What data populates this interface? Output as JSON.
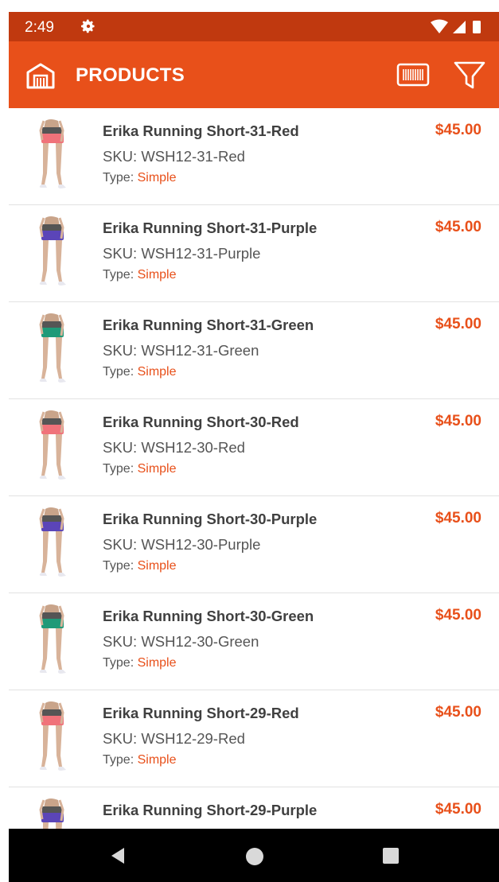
{
  "status_bar": {
    "time": "2:49",
    "icons": [
      "gear-icon",
      "wifi-icon",
      "signal-icon",
      "battery-icon"
    ]
  },
  "app_bar": {
    "title": "PRODUCTS",
    "icons": [
      "store-icon",
      "barcode-scan-icon",
      "filter-icon"
    ]
  },
  "theme": {
    "primary": "#e8501a",
    "status_bar": "#c0390f",
    "text_dark": "#404040",
    "text_muted": "#555555"
  },
  "products": [
    {
      "name": "Erika Running Short-31-Red",
      "sku": "SKU: WSH12-31-Red",
      "type_label": "Type:",
      "type_value": "Simple",
      "price": "$45.00",
      "color": "#f0727a"
    },
    {
      "name": "Erika Running Short-31-Purple",
      "sku": "SKU: WSH12-31-Purple",
      "type_label": "Type:",
      "type_value": "Simple",
      "price": "$45.00",
      "color": "#5b45b8"
    },
    {
      "name": "Erika Running Short-31-Green",
      "sku": "SKU: WSH12-31-Green",
      "type_label": "Type:",
      "type_value": "Simple",
      "price": "$45.00",
      "color": "#1f9a78"
    },
    {
      "name": "Erika Running Short-30-Red",
      "sku": "SKU: WSH12-30-Red",
      "type_label": "Type:",
      "type_value": "Simple",
      "price": "$45.00",
      "color": "#f0727a"
    },
    {
      "name": "Erika Running Short-30-Purple",
      "sku": "SKU: WSH12-30-Purple",
      "type_label": "Type:",
      "type_value": "Simple",
      "price": "$45.00",
      "color": "#5b45b8"
    },
    {
      "name": "Erika Running Short-30-Green",
      "sku": "SKU: WSH12-30-Green",
      "type_label": "Type:",
      "type_value": "Simple",
      "price": "$45.00",
      "color": "#1f9a78"
    },
    {
      "name": "Erika Running Short-29-Red",
      "sku": "SKU: WSH12-29-Red",
      "type_label": "Type:",
      "type_value": "Simple",
      "price": "$45.00",
      "color": "#f0727a"
    },
    {
      "name": "Erika Running Short-29-Purple",
      "sku": "",
      "type_label": "",
      "type_value": "",
      "price": "$45.00",
      "color": "#5b45b8"
    }
  ],
  "nav_bar": {
    "icons": [
      "back-icon",
      "home-icon",
      "recents-icon"
    ]
  }
}
